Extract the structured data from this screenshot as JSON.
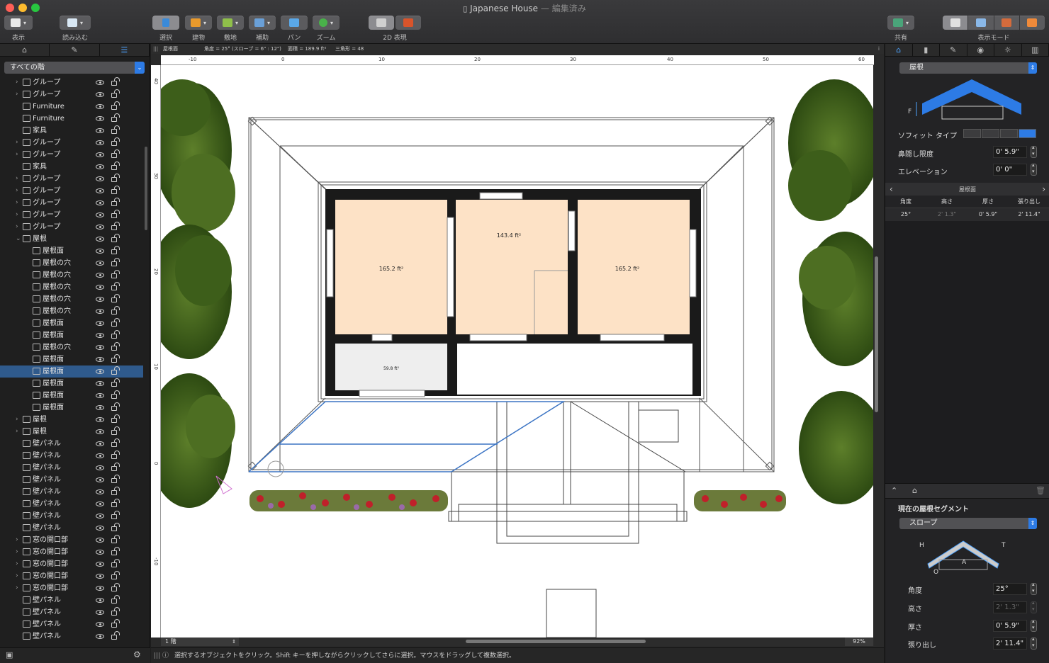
{
  "window": {
    "title": "Japanese House",
    "subtitle": "— 編集済み"
  },
  "toolbar": {
    "view_label": "表示",
    "import_label": "読み込む",
    "select_label": "選択",
    "build_label": "建物",
    "site_label": "敷地",
    "aux_label": "補助",
    "pan_label": "パン",
    "zoom_label": "ズーム",
    "mode2d_label": "2D 表現",
    "share_label": "共有",
    "viewmode_label": "表示モード"
  },
  "left_panel": {
    "floor_select": "すべての階",
    "tree": [
      {
        "label": "グループ",
        "icon": "folder-icon",
        "level": 1,
        "disc": ">",
        "sel": false
      },
      {
        "label": "グループ",
        "icon": "folder-icon",
        "level": 1,
        "disc": ">",
        "sel": false
      },
      {
        "label": "Furniture",
        "icon": "chair-icon",
        "level": 1,
        "disc": "",
        "sel": false
      },
      {
        "label": "Furniture",
        "icon": "chair-icon",
        "level": 1,
        "disc": "",
        "sel": false
      },
      {
        "label": "家具",
        "icon": "chair-icon",
        "level": 1,
        "disc": "",
        "sel": false
      },
      {
        "label": "グループ",
        "icon": "folder-icon",
        "level": 1,
        "disc": ">",
        "sel": false
      },
      {
        "label": "グループ",
        "icon": "folder-icon",
        "level": 1,
        "disc": ">",
        "sel": false
      },
      {
        "label": "家具",
        "icon": "chair-icon",
        "level": 1,
        "disc": "",
        "sel": false
      },
      {
        "label": "グループ",
        "icon": "folder-icon",
        "level": 1,
        "disc": ">",
        "sel": false
      },
      {
        "label": "グループ",
        "icon": "folder-icon",
        "level": 1,
        "disc": ">",
        "sel": false
      },
      {
        "label": "グループ",
        "icon": "folder-icon",
        "level": 1,
        "disc": ">",
        "sel": false
      },
      {
        "label": "グループ",
        "icon": "folder-icon",
        "level": 1,
        "disc": ">",
        "sel": false
      },
      {
        "label": "グループ",
        "icon": "folder-icon",
        "level": 1,
        "disc": ">",
        "sel": false
      },
      {
        "label": "屋根",
        "icon": "roof-icon",
        "level": 1,
        "disc": "v",
        "sel": false
      },
      {
        "label": "屋根面",
        "icon": "roof-plane-icon",
        "level": 2,
        "disc": "",
        "sel": false
      },
      {
        "label": "屋根の穴",
        "icon": "roof-hole-icon",
        "level": 2,
        "disc": "",
        "sel": false
      },
      {
        "label": "屋根の穴",
        "icon": "roof-hole-icon",
        "level": 2,
        "disc": "",
        "sel": false
      },
      {
        "label": "屋根の穴",
        "icon": "roof-hole-icon",
        "level": 2,
        "disc": "",
        "sel": false
      },
      {
        "label": "屋根の穴",
        "icon": "roof-hole-icon",
        "level": 2,
        "disc": "",
        "sel": false
      },
      {
        "label": "屋根の穴",
        "icon": "roof-hole-icon",
        "level": 2,
        "disc": "",
        "sel": false
      },
      {
        "label": "屋根面",
        "icon": "roof-plane-icon",
        "level": 2,
        "disc": "",
        "sel": false
      },
      {
        "label": "屋根面",
        "icon": "roof-plane-icon",
        "level": 2,
        "disc": "",
        "sel": false
      },
      {
        "label": "屋根の穴",
        "icon": "roof-hole-icon",
        "level": 2,
        "disc": "",
        "sel": false
      },
      {
        "label": "屋根面",
        "icon": "roof-plane-icon",
        "level": 2,
        "disc": "",
        "sel": false
      },
      {
        "label": "屋根面",
        "icon": "roof-plane-icon",
        "level": 2,
        "disc": "",
        "sel": true
      },
      {
        "label": "屋根面",
        "icon": "roof-plane-icon",
        "level": 2,
        "disc": "",
        "sel": false
      },
      {
        "label": "屋根面",
        "icon": "roof-plane-icon",
        "level": 2,
        "disc": "",
        "sel": false
      },
      {
        "label": "屋根面",
        "icon": "roof-plane-icon",
        "level": 2,
        "disc": "",
        "sel": false
      },
      {
        "label": "屋根",
        "icon": "roof-icon",
        "level": 1,
        "disc": ">",
        "sel": false
      },
      {
        "label": "屋根",
        "icon": "roof-icon",
        "level": 1,
        "disc": ">",
        "sel": false
      },
      {
        "label": "壁パネル",
        "icon": "wall-panel-icon",
        "level": 1,
        "disc": "",
        "sel": false
      },
      {
        "label": "壁パネル",
        "icon": "wall-panel-icon",
        "level": 1,
        "disc": "",
        "sel": false
      },
      {
        "label": "壁パネル",
        "icon": "wall-panel-icon",
        "level": 1,
        "disc": "",
        "sel": false
      },
      {
        "label": "壁パネル",
        "icon": "wall-panel-icon",
        "level": 1,
        "disc": "",
        "sel": false
      },
      {
        "label": "壁パネル",
        "icon": "wall-panel-icon",
        "level": 1,
        "disc": "",
        "sel": false
      },
      {
        "label": "壁パネル",
        "icon": "wall-panel-icon",
        "level": 1,
        "disc": "",
        "sel": false
      },
      {
        "label": "壁パネル",
        "icon": "wall-panel-icon",
        "level": 1,
        "disc": "",
        "sel": false
      },
      {
        "label": "壁パネル",
        "icon": "wall-panel-icon",
        "level": 1,
        "disc": "",
        "sel": false
      },
      {
        "label": "窓の開口部",
        "icon": "window-opening-icon",
        "level": 1,
        "disc": ">",
        "sel": false
      },
      {
        "label": "窓の開口部",
        "icon": "window-opening-icon",
        "level": 1,
        "disc": ">",
        "sel": false
      },
      {
        "label": "窓の開口部",
        "icon": "window-opening-icon",
        "level": 1,
        "disc": ">",
        "sel": false
      },
      {
        "label": "窓の開口部",
        "icon": "window-opening-icon",
        "level": 1,
        "disc": ">",
        "sel": false
      },
      {
        "label": "窓の開口部",
        "icon": "window-opening-icon",
        "level": 1,
        "disc": ">",
        "sel": false
      },
      {
        "label": "壁パネル",
        "icon": "wall-panel-icon",
        "level": 1,
        "disc": "",
        "sel": false
      },
      {
        "label": "壁パネル",
        "icon": "wall-panel-icon",
        "level": 1,
        "disc": "",
        "sel": false
      },
      {
        "label": "壁パネル",
        "icon": "wall-panel-icon",
        "level": 1,
        "disc": "",
        "sel": false
      },
      {
        "label": "壁パネル",
        "icon": "wall-panel-icon",
        "level": 1,
        "disc": "",
        "sel": false
      }
    ]
  },
  "canvas": {
    "info": {
      "name": "屋根面",
      "angle": "角度 = 25° (スロープ = 6\" : 12\")",
      "area": "面積 = 189.9 ft²",
      "triangles": "三角形 = 48"
    },
    "ruler_top": [
      "-10",
      "0",
      "10",
      "20",
      "30",
      "40",
      "50",
      "60"
    ],
    "ruler_left": [
      "40",
      "30",
      "20",
      "10",
      "0",
      "-10"
    ],
    "rooms": {
      "room1": "165.2 ft²",
      "room2": "143.4 ft²",
      "room3": "165.2 ft²",
      "room4": "59.8 ft²"
    },
    "floor_combo": "1 階",
    "zoom": "92%"
  },
  "status_text": "選択するオブジェクトをクリック。Shift キーを押しながらクリックしてさらに選択。マウスをドラッグして複数選択。",
  "right_panel": {
    "object_type": "屋根",
    "soffit_label": "ソフィット タイプ",
    "eave_label": "鼻隠し限度",
    "eave_value": "0' 5.9\"",
    "elevation_label": "エレベーション",
    "elevation_value": "0' 0\"",
    "diagram_letter_f": "F",
    "segment_nav": "屋根面",
    "table_headers": [
      "角度",
      "高さ",
      "厚さ",
      "張り出し"
    ],
    "table_row": [
      "25°",
      "2' 1.3\"",
      "0' 5.9\"",
      "2' 11.4\""
    ],
    "current_segment_title": "現在の屋根セグメント",
    "segment_type": "スロープ",
    "diagram_letters": {
      "h": "H",
      "t": "T",
      "a": "A",
      "o": "O"
    },
    "angle_label": "角度",
    "angle_value": "25°",
    "height_label": "高さ",
    "height_value": "2' 1.3\"",
    "thickness_label": "厚さ",
    "thickness_value": "0' 5.9\"",
    "overhang_label": "張り出し",
    "overhang_value": "2' 11.4\""
  },
  "colors": {
    "accent": "#2d7be5",
    "room_fill": "#fde2c6",
    "wall": "#1a1a1a",
    "selection": "#2f5a8c",
    "roof_line": "#3b74c4"
  }
}
